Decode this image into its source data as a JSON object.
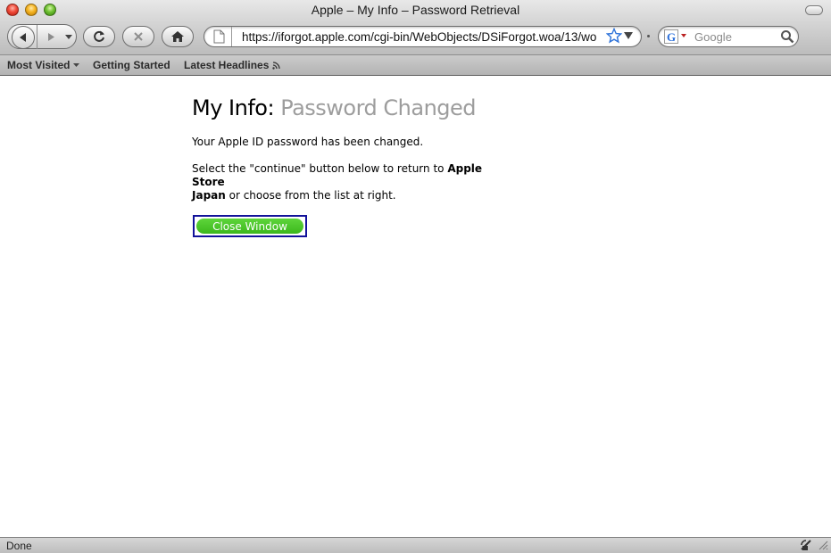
{
  "window": {
    "title": "Apple – My Info – Password Retrieval"
  },
  "toolbar": {
    "url": "https://iforgot.apple.com/cgi-bin/WebObjects/DSiForgot.woa/13/wo",
    "search_placeholder": "Google",
    "search_engine_letter": "G"
  },
  "bookmarks": {
    "items": [
      {
        "label": "Most Visited"
      },
      {
        "label": "Getting Started"
      },
      {
        "label": "Latest Headlines"
      }
    ]
  },
  "page": {
    "heading_lead": "My Info:",
    "heading_sub": "Password Changed",
    "para1": "Your Apple ID password has been changed.",
    "para2_pre": "Select the \"continue\" button below to return to ",
    "para2_bold1": "Apple Store",
    "para2_bold2": "Japan",
    "para2_post": " or choose from the list at right.",
    "button_label": "Close Window"
  },
  "status": {
    "text": "Done"
  }
}
